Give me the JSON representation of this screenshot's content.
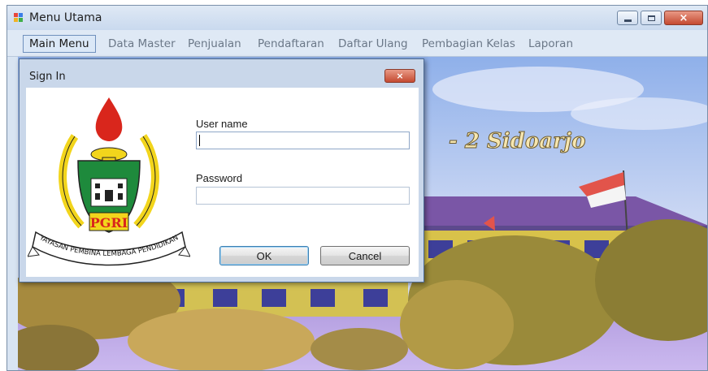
{
  "window": {
    "title": "Menu Utama",
    "controls": {
      "minimize_icon": "minimize-icon",
      "maximize_icon": "maximize-icon",
      "close_icon": "close-icon",
      "close_glyph": "×"
    }
  },
  "menu": {
    "items": [
      {
        "label": "Main Menu",
        "active": true
      },
      {
        "label": "Data Master",
        "active": false
      },
      {
        "label": "Penjualan",
        "active": false
      },
      {
        "label": "Pendaftaran",
        "active": false
      },
      {
        "label": "Daftar Ulang",
        "active": false
      },
      {
        "label": "Pembagian Kelas",
        "active": false
      },
      {
        "label": "Laporan",
        "active": false
      }
    ]
  },
  "background": {
    "banner_text": "- 2 Sidoarjo"
  },
  "dialog": {
    "title": "Sign In",
    "close_glyph": "×",
    "logo": {
      "name": "pgri-logo",
      "acronym": "PGRI",
      "ribbon_text": "YAYASAN PEMBINA LEMBAGA PENDIDIKAN"
    },
    "username": {
      "label": "User name",
      "value": ""
    },
    "password": {
      "label": "Password",
      "value": ""
    },
    "ok_label": "OK",
    "cancel_label": "Cancel"
  },
  "colors": {
    "menu_active_border": "#6f90bd",
    "close_button": "#c44a31",
    "logo_green": "#1e8a3c",
    "logo_yellow": "#f2d51c",
    "logo_red": "#d9261c"
  }
}
